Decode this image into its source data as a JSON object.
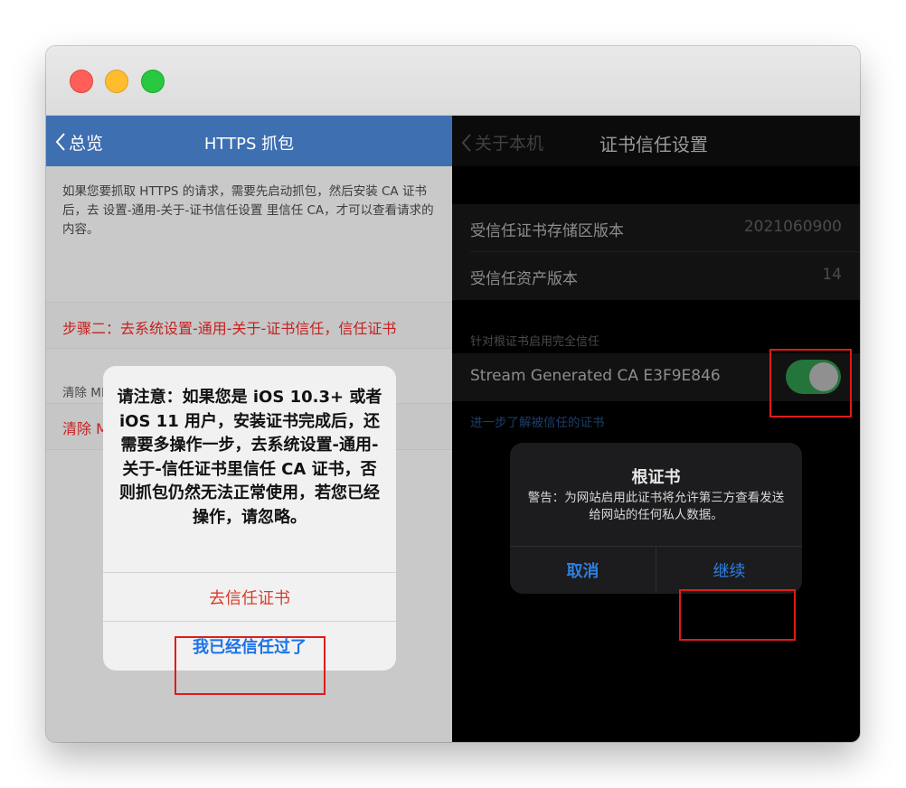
{
  "left": {
    "nav": {
      "back_label": "总览",
      "title": "HTTPS 抓包"
    },
    "description": "如果您要抓取 HTTPS 的请求，需要先启动抓包，然后安装 CA 证书后，去 设置-通用-关于-证书信任设置 里信任 CA，才可以查看请求的内容。",
    "step2_label": "步骤二：去系统设置-通用-关于-证书信任，信任证书",
    "section_header": "清除 MITM 缓存",
    "clear_label": "清除 MITM 缓存",
    "alert": {
      "message": "请注意：如果您是 iOS 10.3+ 或者 iOS 11 用户，安装证书完成后，还需要多操作一步，去系统设置-通用-关于-信任证书里信任 CA 证书，否则抓包仍然无法正常使用，若您已经操作，请忽略。",
      "trust_button": "去信任证书",
      "trusted_button": "我已经信任过了"
    }
  },
  "right": {
    "nav": {
      "back_label": "关于本机",
      "title": "证书信任设置"
    },
    "rows": [
      {
        "label": "受信任证书存储区版本",
        "value": "2021060900"
      },
      {
        "label": "受信任资产版本",
        "value": "14"
      }
    ],
    "trust_section_header": "针对根证书启用完全信任",
    "ca_name": "Stream Generated CA E3F9E846",
    "toggle_on": true,
    "learn_more": "进一步了解被信任的证书",
    "alert": {
      "title": "根证书",
      "message": "警告：为网站启用此证书将允许第三方查看发送给网站的任何私人数据。",
      "cancel_button": "取消",
      "continue_button": "继续"
    }
  },
  "colors": {
    "nav_blue": "#3e6fb1",
    "destructive_red": "#d93a2b",
    "link_blue": "#1a73e8",
    "highlight_red": "#e01b1b",
    "toggle_green": "#24753b"
  }
}
